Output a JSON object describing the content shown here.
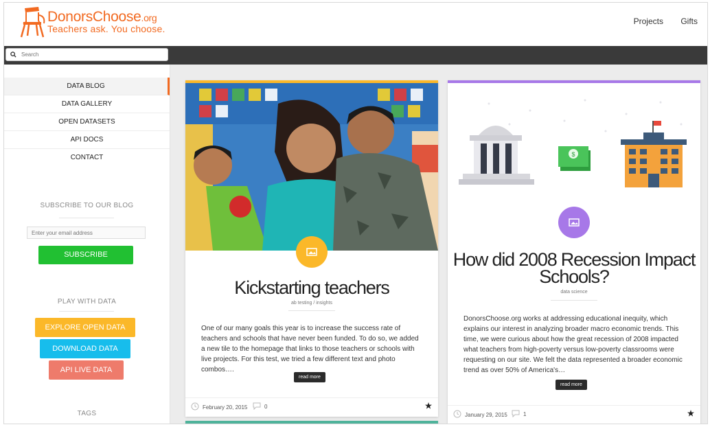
{
  "header": {
    "brand_main": "DonorsChoose",
    "brand_suffix": ".org",
    "tagline": "Teachers ask. You choose.",
    "nav": [
      "Projects",
      "Gifts"
    ]
  },
  "search": {
    "placeholder": "Search"
  },
  "sidebar": {
    "menu": [
      "DATA BLOG",
      "DATA GALLERY",
      "OPEN DATASETS",
      "API DOCS",
      "CONTACT"
    ],
    "subscribe_heading": "SUBSCRIBE TO OUR BLOG",
    "email_placeholder": "Enter your email address",
    "subscribe_button": "SUBSCRIBE",
    "play_heading": "PLAY WITH DATA",
    "explore_button": "EXPLORE OPEN DATA",
    "download_button": "DOWNLOAD DATA",
    "api_button": "API LIVE DATA",
    "tags_heading": "TAGS"
  },
  "posts": [
    {
      "title": "Kickstarting teachers",
      "category": "ab testing / insights",
      "excerpt": "One of our many goals this year is to increase the success rate of teachers and schools that have never been funded. To do so, we added a new tile to the homepage that links to those teachers or schools with live projects. For this test, we tried a few different text and photo combos….",
      "read_more": "read more",
      "date": "February 20, 2015",
      "comments": "0"
    },
    {
      "title": "How did 2008 Recession Impact Schools?",
      "category": "data science",
      "excerpt": "DonorsChoose.org works at addressing educational inequity, which explains our interest in analyzing broader macro economic trends. This time, we were curious about how the great recession of 2008 impacted what teachers from high-poverty versus low-poverty classrooms were requesting on our site. We felt the data represented a broader economic trend as over 50% of America's…",
      "read_more": "read more",
      "date": "January 29, 2015",
      "comments": "1"
    }
  ],
  "colors": {
    "brand_orange": "#f26a21",
    "subscribe_green": "#21c032",
    "explore_yellow": "#fbb829",
    "download_blue": "#17bdec",
    "api_salmon": "#ee7b6b",
    "card1_accent": "#fbb829",
    "card2_accent": "#a778e8"
  },
  "icons": [
    "logo-chair-icon",
    "search-icon",
    "image-icon",
    "clock-icon",
    "comment-icon",
    "star-icon"
  ]
}
